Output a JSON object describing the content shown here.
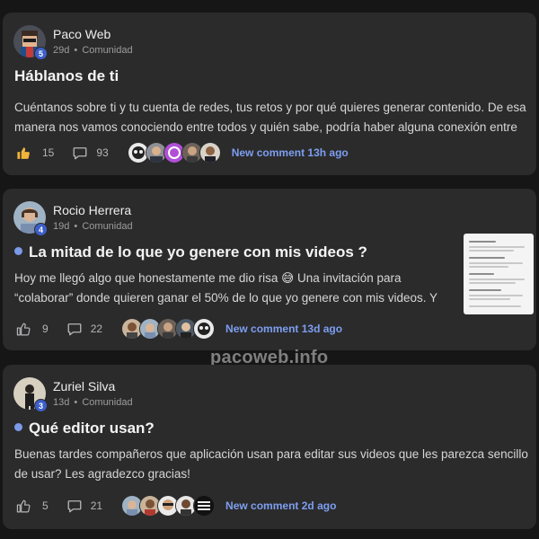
{
  "posts": [
    {
      "author": "Paco Web",
      "level": "5",
      "time": "29d",
      "separator": "•",
      "category": "Comunidad",
      "title": "Háblanos de ti",
      "pinned": false,
      "body": "Cuéntanos sobre ti y tu cuenta de redes, tus retos y por qué quieres generar contenido. De esa manera nos vamos conociendo entre todos y quién sabe, podría haber alguna conexión entre",
      "likes": "15",
      "liked": true,
      "comments": "93",
      "new_comment": "New comment 13h ago"
    },
    {
      "author": "Rocio Herrera",
      "level": "4",
      "time": "19d",
      "separator": "•",
      "category": "Comunidad",
      "title": "La mitad de lo que yo genere con mis videos ?",
      "pinned": true,
      "body": "Hoy me llegó algo que honestamente me dio risa 😅 Una invitación para “colaborar” donde quieren ganar el 50% de lo que yo genere con mis videos. Y",
      "likes": "9",
      "liked": false,
      "comments": "22",
      "new_comment": "New comment 13d ago"
    },
    {
      "author": "Zuriel Silva",
      "level": "3",
      "time": "13d",
      "separator": "•",
      "category": "Comunidad",
      "title": "Qué editor usan?",
      "pinned": true,
      "body": "Buenas tardes compañeros que aplicación usan para editar sus videos que les parezca sencillo de usar? Les agradezco gracias!",
      "likes": "5",
      "liked": false,
      "comments": "21",
      "new_comment": "New comment 2d ago"
    }
  ],
  "watermark": "pacoweb.info",
  "colors": {
    "background": "#161617",
    "card": "#2b2b2c",
    "accent": "#7d9ef0",
    "level_badge": "#3d5fc9",
    "liked": "#f2b43a"
  }
}
